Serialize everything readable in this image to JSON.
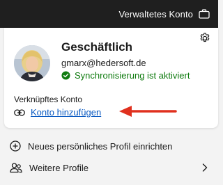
{
  "topbar": {
    "account_label": "Verwaltetes Konto",
    "icon": "briefcase-icon"
  },
  "profile": {
    "name": "Geschäftlich",
    "email": "gmarx@hedersoft.de",
    "sync_status": "Synchronisierung ist aktiviert",
    "sync_color": "#0f7b0f",
    "settings_icon": "gear-icon"
  },
  "linked_account": {
    "label": "Verknüpftes Konto",
    "add_link": "Konto hinzufügen",
    "link_color": "#0a5ac2"
  },
  "menu": {
    "new_profile": "Neues persönliches Profil einrichten",
    "more_profiles": "Weitere Profile"
  },
  "colors": {
    "topbar_bg": "#1f1f1f",
    "annotation_arrow": "#e0301e"
  }
}
